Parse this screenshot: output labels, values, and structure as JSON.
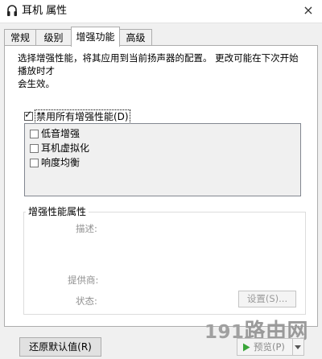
{
  "window": {
    "title": "耳机 属性",
    "close_glyph": "×",
    "icon": "headphone-icon"
  },
  "tabs": [
    {
      "label": "常规",
      "active": false
    },
    {
      "label": "级别",
      "active": false
    },
    {
      "label": "增强功能",
      "active": true
    },
    {
      "label": "高级",
      "active": false
    }
  ],
  "enhancements": {
    "description_line1": "选择增强性能，将其应用到当前扬声器的配置。 更改可能在下次开始播放时才",
    "description_line2": "会生效。",
    "disable_all_label": "禁用所有增强性能(D)",
    "disable_all_checked": true,
    "check_glyph": "✓",
    "items": [
      {
        "label": "低音增强",
        "checked": false
      },
      {
        "label": "耳机虚拟化",
        "checked": false
      },
      {
        "label": "响度均衡",
        "checked": false
      }
    ]
  },
  "properties": {
    "group_title": "增强性能属性",
    "description_label": "描述:",
    "provider_label": "提供商:",
    "status_label": "状态:",
    "settings_button": "设置(S)..."
  },
  "footer": {
    "restore_defaults_button": "还原默认值(R)",
    "preview_button": "预览(P)",
    "watermark_prefix": "191",
    "watermark_text": "路由网"
  }
}
